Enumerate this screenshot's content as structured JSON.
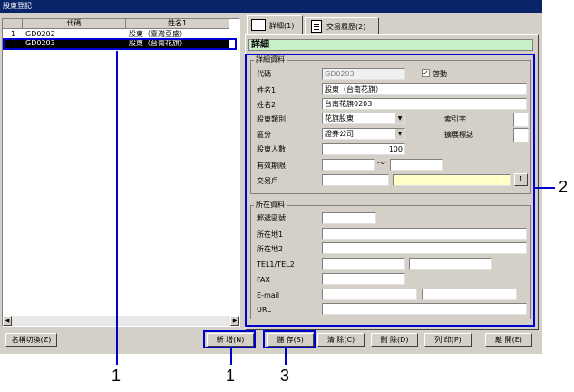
{
  "window": {
    "title": "股東登記"
  },
  "list": {
    "headers": [
      "代碼",
      "姓名1"
    ],
    "rows": [
      {
        "num": "1",
        "code": "GD0202",
        "name": "股東（臺灣亞盛）"
      },
      {
        "num": "",
        "code": "GD0203",
        "name": "股東（台南花旗）"
      }
    ]
  },
  "tabs": [
    {
      "label": "詳細(1)"
    },
    {
      "label": "交易履歷(2)"
    }
  ],
  "detail": {
    "header": "詳細",
    "group1_title": "詳細資料",
    "group2_title": "所在資料",
    "labels": {
      "code": "代碼",
      "name1": "姓名1",
      "name2": "姓名2",
      "category": "股東類別",
      "division": "區分",
      "count": "股東人數",
      "period": "有效期限",
      "account": "交易戶",
      "index": "索引字",
      "flag": "擴展標誌",
      "postal": "郵遞區號",
      "addr1": "所在地1",
      "addr2": "所在地2",
      "tel": "TEL1/TEL2",
      "fax": "FAX",
      "email": "E-mail",
      "url": "URL"
    },
    "values": {
      "code": "GD0203",
      "name1": "股東（台南花旗）",
      "name2": "台南花旗0203",
      "category": "花旗股東",
      "division": "證券公司",
      "count": "100"
    },
    "enable_label": "啓動",
    "period_sep": "〜",
    "account_btn": "1"
  },
  "buttons": {
    "switch_name": "名稱切換(Z)",
    "new": "新 增(N)",
    "save": "儲 存(S)",
    "clear": "清 除(C)",
    "delete": "刪 除(D)",
    "print": "列 印(P)",
    "close": "離 開(E)"
  },
  "callouts": [
    "1",
    "1",
    "3",
    "2"
  ]
}
